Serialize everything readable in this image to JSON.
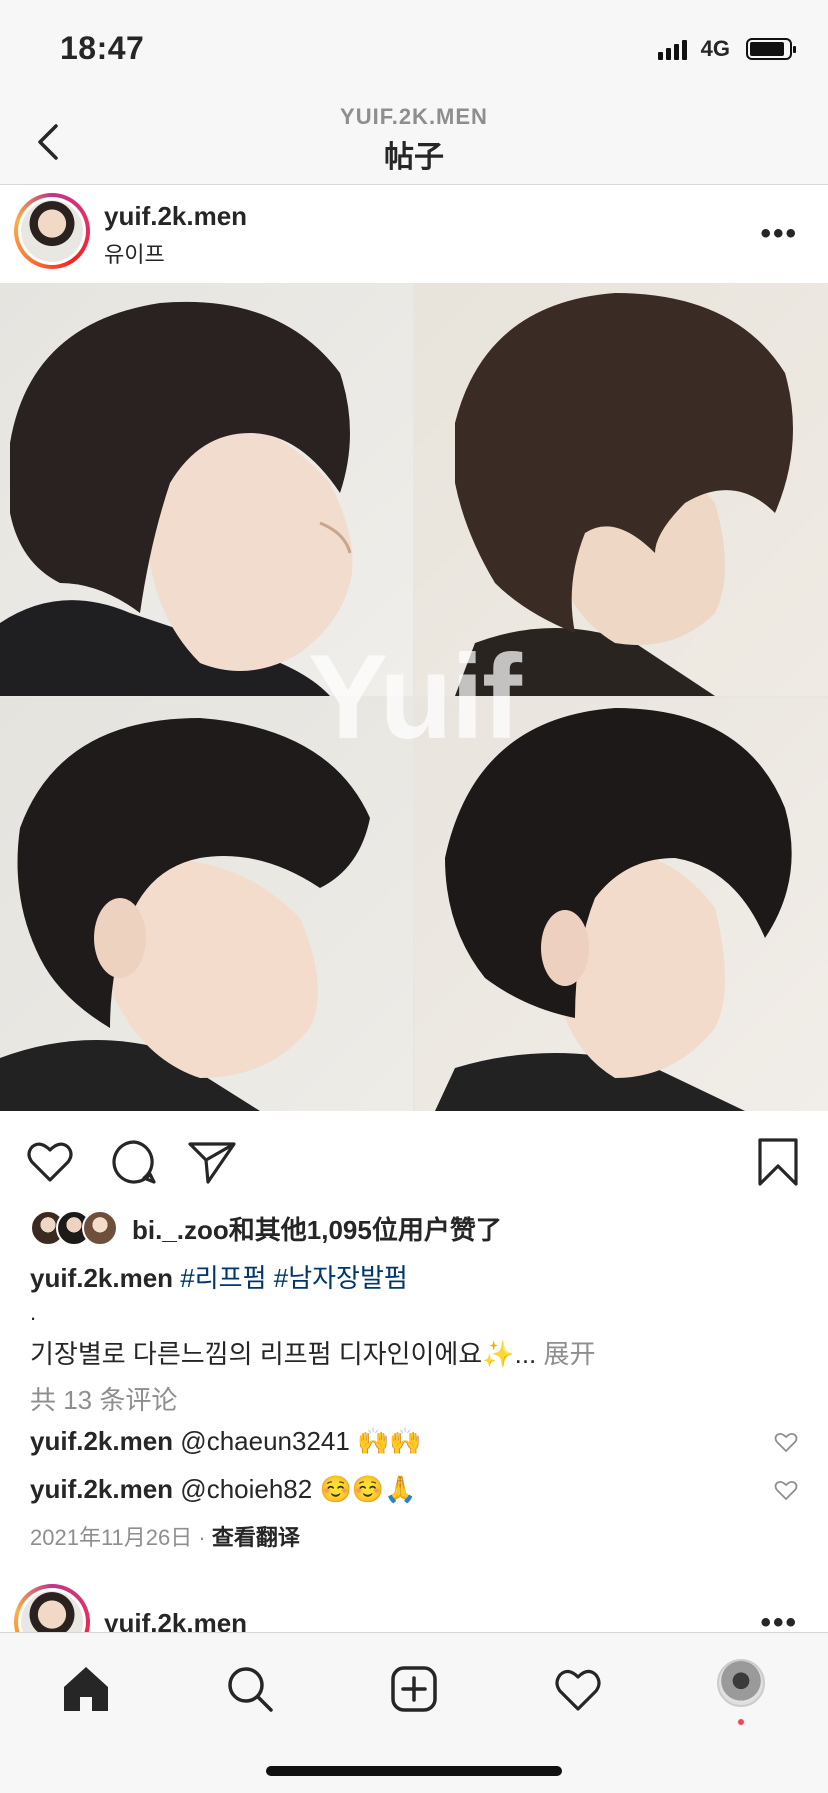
{
  "status": {
    "time": "18:47",
    "network": "4G"
  },
  "nav": {
    "subtitle": "YUIF.2K.MEN",
    "title": "帖子"
  },
  "post": {
    "username": "yuif.2k.men",
    "subname": "유이프",
    "more": "•••",
    "watermark": "Yuif",
    "likes_text": "bi._.zoo和其他1,095位用户赞了",
    "caption_user": "yuif.2k.men",
    "hashtags": "#리프펌 #남자장발펌",
    "dot": ".",
    "description": "기장별로 다른느낌의 리프펌 디자인이에요✨...",
    "expand": "展开",
    "view_comments": "共 13 条评论",
    "comments": [
      {
        "user": "yuif.2k.men",
        "text": "@chaeun3241 🙌🙌"
      },
      {
        "user": "yuif.2k.men",
        "text": "@choieh82 ☺️☺️🙏"
      }
    ],
    "date": "2021年11月26日",
    "separator": "·",
    "translate": "查看翻译"
  },
  "next_post": {
    "username": "yuif.2k.men",
    "more": "•••"
  },
  "colors": {
    "accent_link": "#00376b",
    "notification_dot": "#ed4956",
    "muted": "#8e8e8e"
  }
}
